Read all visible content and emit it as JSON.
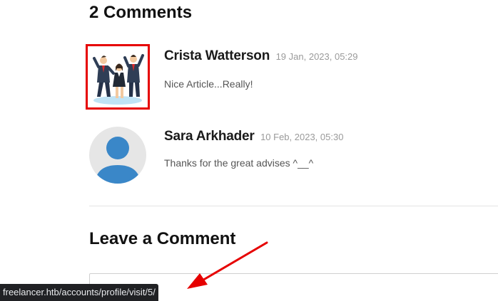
{
  "comments_section": {
    "heading": "2 Comments",
    "comments": [
      {
        "author": "Crista Watterson",
        "date": "19 Jan, 2023, 05:29",
        "text": "Nice Article...Really!",
        "avatar_icon": "business-team-avatar-icon"
      },
      {
        "author": "Sara Arkhader",
        "date": "10 Feb, 2023, 05:30",
        "text": "Thanks for the great advises ^__^",
        "avatar_icon": "default-user-avatar-icon"
      }
    ]
  },
  "leave_comment": {
    "heading": "Leave a Comment"
  },
  "status_bar": {
    "url": "freelancer.htb/accounts/profile/visit/5/"
  },
  "colors": {
    "highlight_border": "#e60000",
    "annotation_arrow": "#e60000",
    "avatar_blue": "#3a87c8",
    "avatar_bg": "#e6e6e6",
    "status_bar_bg": "#202124"
  }
}
